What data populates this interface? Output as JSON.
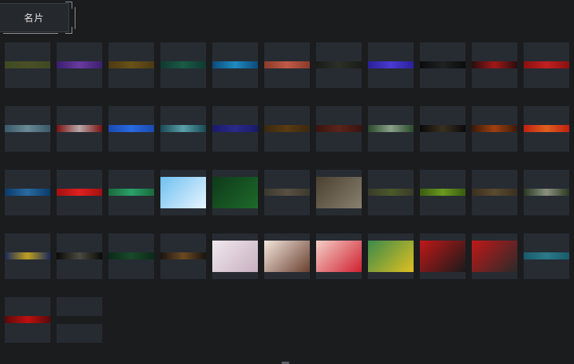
{
  "tab": {
    "label": "名片"
  },
  "cards": [
    {
      "kind": "strip",
      "c1": "#3f4a22",
      "c2": "#4a4f25"
    },
    {
      "kind": "strip",
      "c1": "#3a1f6e",
      "c2": "#6a3aa0"
    },
    {
      "kind": "strip",
      "c1": "#4b3a12",
      "c2": "#6a5218"
    },
    {
      "kind": "strip",
      "c1": "#0f3a30",
      "c2": "#1a5a46"
    },
    {
      "kind": "strip",
      "c1": "#0c4b7a",
      "c2": "#1f8ac2"
    },
    {
      "kind": "strip",
      "c1": "#8a3a2a",
      "c2": "#c25a48"
    },
    {
      "kind": "strip",
      "c1": "#1a1c18",
      "c2": "#2c2f26"
    },
    {
      "kind": "strip",
      "c1": "#2a1f9a",
      "c2": "#4a3ad0"
    },
    {
      "kind": "strip",
      "c1": "#0b0c0d",
      "c2": "#1e2022"
    },
    {
      "kind": "strip",
      "c1": "#2a0d0d",
      "c2": "#a01818"
    },
    {
      "kind": "strip",
      "c1": "#8a1010",
      "c2": "#c22020"
    },
    {
      "kind": "strip",
      "c1": "#3a5a6a",
      "c2": "#6a8a96"
    },
    {
      "kind": "strip",
      "c1": "#7a1010",
      "c2": "#b8a8a8"
    },
    {
      "kind": "strip",
      "c1": "#1a4ab0",
      "c2": "#2a6ae0"
    },
    {
      "kind": "strip",
      "c1": "#1a4a54",
      "c2": "#5aa0aa"
    },
    {
      "kind": "strip",
      "c1": "#1a1a6a",
      "c2": "#2a2a8a"
    },
    {
      "kind": "strip",
      "c1": "#3a2a10",
      "c2": "#5a3a12"
    },
    {
      "kind": "strip",
      "c1": "#3a1410",
      "c2": "#5a2418"
    },
    {
      "kind": "strip",
      "c1": "#2a4a2a",
      "c2": "#8aa08a"
    },
    {
      "kind": "strip",
      "c1": "#0a0a0a",
      "c2": "#3a3020"
    },
    {
      "kind": "strip",
      "c1": "#3a1a0a",
      "c2": "#a04010"
    },
    {
      "kind": "strip",
      "c1": "#c02010",
      "c2": "#e06020"
    },
    {
      "kind": "strip",
      "c1": "#0a3a6a",
      "c2": "#2a6aa0"
    },
    {
      "kind": "strip",
      "c1": "#a01010",
      "c2": "#e02020"
    },
    {
      "kind": "strip",
      "c1": "#1a6a3a",
      "c2": "#2aa06a"
    },
    {
      "kind": "full",
      "c1": "#6ec0f0",
      "c2": "#e8f4ff"
    },
    {
      "kind": "full",
      "c1": "#0e3a1a",
      "c2": "#1e6a2a"
    },
    {
      "kind": "strip",
      "c1": "#3a3a30",
      "c2": "#5a5040"
    },
    {
      "kind": "full",
      "c1": "#4a4030",
      "c2": "#8a8070"
    },
    {
      "kind": "strip",
      "c1": "#3a3a2a",
      "c2": "#4a5a2a"
    },
    {
      "kind": "strip",
      "c1": "#3a5a10",
      "c2": "#6a9a20"
    },
    {
      "kind": "strip",
      "c1": "#3a3020",
      "c2": "#5a4a30"
    },
    {
      "kind": "strip",
      "c1": "#2a3a20",
      "c2": "#8a9080"
    },
    {
      "kind": "strip",
      "c1": "#1a2a5a",
      "c2": "#c0a020"
    },
    {
      "kind": "strip",
      "c1": "#0a0a0a",
      "c2": "#4a4a40"
    },
    {
      "kind": "strip",
      "c1": "#0a2a1a",
      "c2": "#1a4a2a"
    },
    {
      "kind": "strip",
      "c1": "#1a1410",
      "c2": "#6a4a20"
    },
    {
      "kind": "full",
      "c1": "#f0e8ee",
      "c2": "#c8b0c0"
    },
    {
      "kind": "full",
      "c1": "#f4e6dc",
      "c2": "#6a4030"
    },
    {
      "kind": "full",
      "c1": "#f4d0c8",
      "c2": "#d02030"
    },
    {
      "kind": "full",
      "c1": "#3a8a4a",
      "c2": "#e0c020"
    },
    {
      "kind": "full",
      "c1": "#c01818",
      "c2": "#1a1a1a"
    },
    {
      "kind": "full",
      "c1": "#c01818",
      "c2": "#2a2a2a"
    },
    {
      "kind": "strip",
      "c1": "#1a5a6a",
      "c2": "#2a7a8a"
    },
    {
      "kind": "strip",
      "c1": "#5a0a0a",
      "c2": "#c01010"
    },
    {
      "kind": "split",
      "c1": "#1b1c1e",
      "c2": "#1b1c1e"
    }
  ]
}
